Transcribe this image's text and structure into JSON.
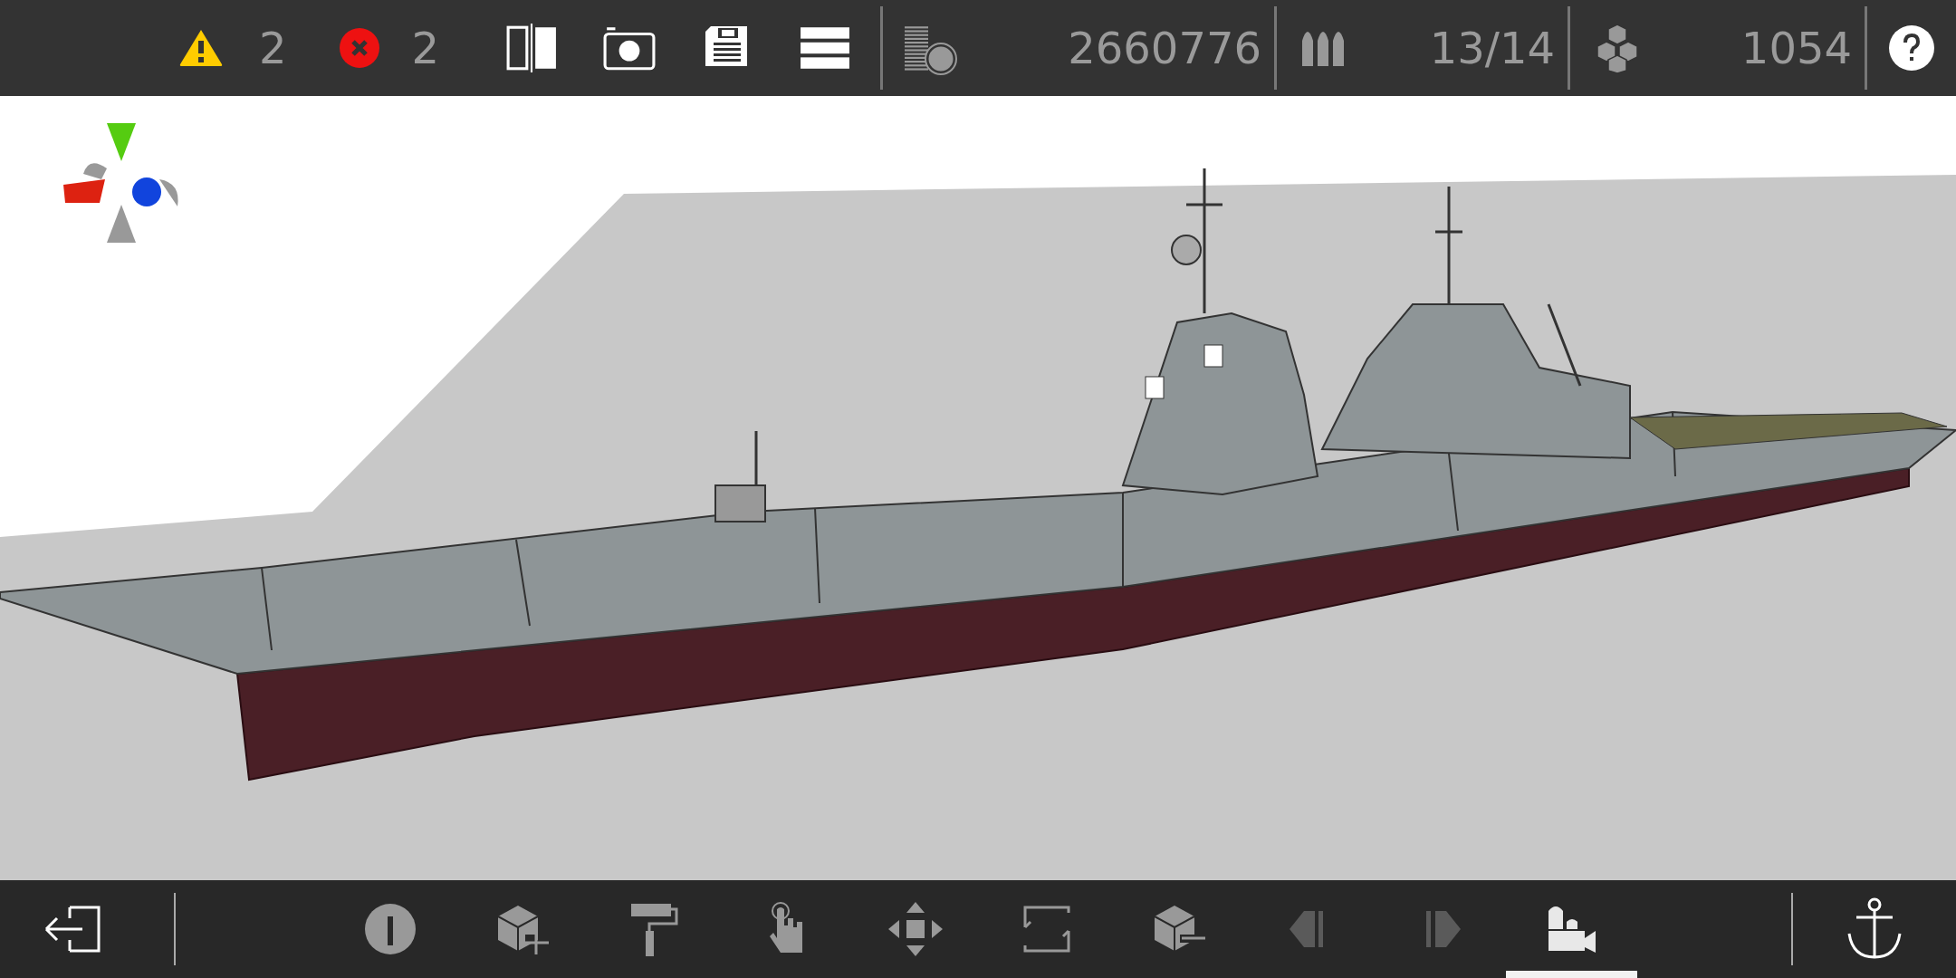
{
  "status": {
    "warnings": "2",
    "errors": "2"
  },
  "top_buttons": [
    {
      "kind": "split"
    },
    {
      "kind": "camera"
    },
    {
      "kind": "save"
    },
    {
      "kind": "menu"
    }
  ],
  "stats": [
    {
      "kind": "mass",
      "value": "2660776"
    },
    {
      "kind": "ammo",
      "value": "13/14"
    },
    {
      "kind": "blocks",
      "value": "1054"
    }
  ],
  "bottom_tools": [
    {
      "kind": "info",
      "selected": false,
      "disabled": false
    },
    {
      "kind": "add-block",
      "selected": false,
      "disabled": false
    },
    {
      "kind": "paint",
      "selected": false,
      "disabled": false
    },
    {
      "kind": "touch",
      "selected": false,
      "disabled": false
    },
    {
      "kind": "move",
      "selected": false,
      "disabled": false
    },
    {
      "kind": "frame",
      "selected": false,
      "disabled": false
    },
    {
      "kind": "remove-block",
      "selected": false,
      "disabled": false
    },
    {
      "kind": "prev",
      "selected": false,
      "disabled": true
    },
    {
      "kind": "next",
      "selected": false,
      "disabled": true
    },
    {
      "kind": "view",
      "selected": true,
      "disabled": false
    }
  ]
}
